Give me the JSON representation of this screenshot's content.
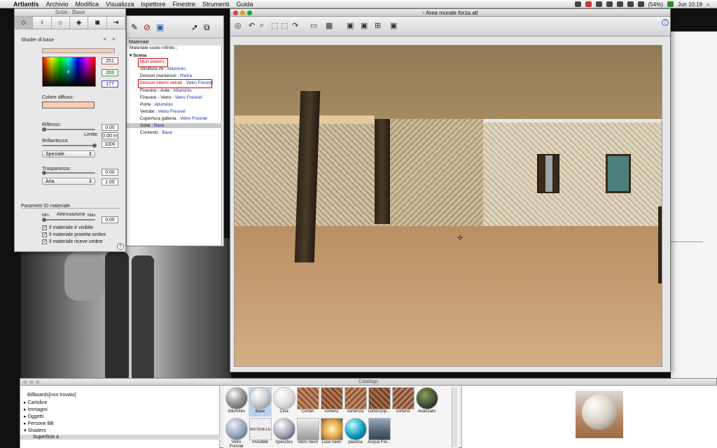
{
  "menubar": {
    "app": "Artlantis",
    "items": [
      "Archivio",
      "Modifica",
      "Visualizza",
      "Ispettore",
      "Finestre",
      "Strumenti",
      "Guida"
    ],
    "battery": "(54%)",
    "clock": "Jun 10:19"
  },
  "shader_panel": {
    "title": "Solai : Base",
    "section": "Shader di base",
    "rgb": [
      "251",
      "203",
      "177"
    ],
    "colore_diffuso": "Colore diffuso:",
    "riflesso": {
      "label": "Riflesso:",
      "value": "0.00"
    },
    "limite": {
      "label": "Limite:",
      "value": "0.00 m"
    },
    "brillantezza": {
      "label": "Brillantezza:",
      "value": "1000"
    },
    "speciale": "Speciale",
    "trasparenza": {
      "label": "Trasparenza:",
      "value": "0.00"
    },
    "aria": {
      "label": "Aria",
      "value": "1.00"
    },
    "parametri": "Parametri ID materiale",
    "min": "Min.",
    "attenuazione": "Attenuazione",
    "max": "Max.",
    "att_value": "0.00",
    "checks": [
      "Il materiale è visibile",
      "Il materiale proietta ombre",
      "Il materiale riceve ombre"
    ],
    "help": "?",
    "accent_color": "#fbcbb1"
  },
  "materials_panel": {
    "header": "Materiale",
    "rows": [
      {
        "label": "Materiale suolo infinito :",
        "value": ""
      },
      {
        "label": "Scena",
        "value": ""
      },
      {
        "label": "Muri esterni :",
        "value": ""
      },
      {
        "label": "Struttura ml :",
        "value": "Alluminio"
      },
      {
        "label": "Divisori mantenuti :",
        "value": "Pietra"
      },
      {
        "label": "Divisori interni vetrati :",
        "value": "Vetro Fresnel"
      },
      {
        "label": "Finestre - Ante :",
        "value": "Alluminio"
      },
      {
        "label": "Finestre - Vetro :",
        "value": "Vetro Fresnel"
      },
      {
        "label": "Porte :",
        "value": "Alluminio"
      },
      {
        "label": "Vetrate :",
        "value": "Vetro Fresnel"
      },
      {
        "label": "Copertura galleria :",
        "value": "Vetro Fresnel"
      },
      {
        "label": "Solai :",
        "value": "Base"
      },
      {
        "label": "Contesto :",
        "value": "Base"
      }
    ]
  },
  "viewport": {
    "title": "Area murate forza.atl",
    "help": "?"
  },
  "catalog": {
    "title": "Catalogo",
    "tree": [
      "Billboards[non trovato]",
      "Cartoline",
      "Immagini",
      "Oggetti",
      "Persone BB",
      "Shaders",
      "Superficie a"
    ],
    "swatches_row1": [
      "Alluminio",
      "Base",
      "Cina",
      "Corten",
      "corten2",
      "corten2a",
      "corten2op...",
      "corten3",
      "Avanzato"
    ],
    "swatches_row2": [
      "Vetro Fresnel",
      "Invisibile",
      "Specchio",
      "Vetro neon",
      "Luce neon",
      "plastica",
      "Acqua Fre..."
    ],
    "invisible_text": "INVISIBILE"
  }
}
